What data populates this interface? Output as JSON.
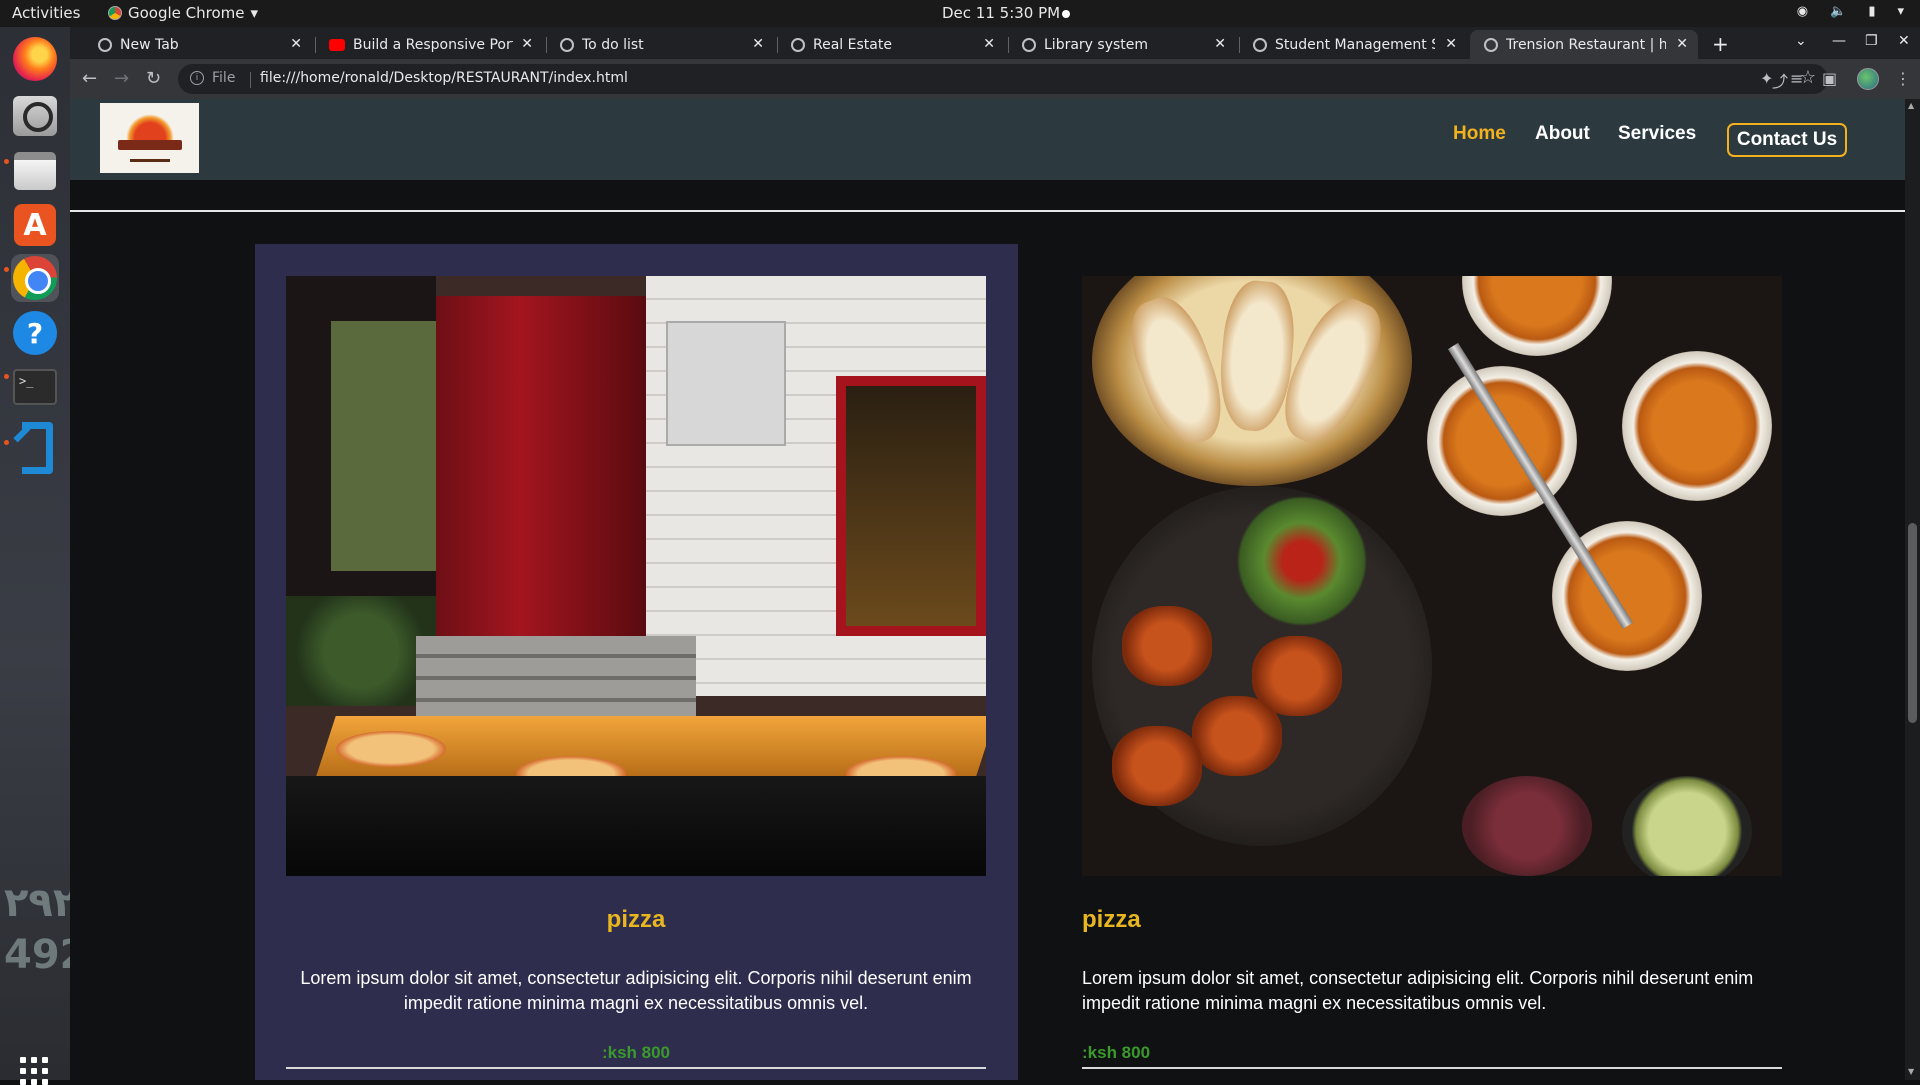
{
  "system": {
    "activities": "Activities",
    "app_name": "Google Chrome",
    "clock": "Dec 11  5:30 PM"
  },
  "dock": {
    "icons": [
      "firefox-icon",
      "magnifier-icon",
      "files-icon",
      "software-store-icon",
      "chrome-icon",
      "help-icon",
      "terminal-icon",
      "vscode-icon",
      "app-grid-icon"
    ],
    "store_glyph": "A",
    "help_glyph": "?",
    "terminal_glyph": ">_"
  },
  "browser": {
    "tabs": [
      {
        "title": "New Tab",
        "icon": "globe-icon"
      },
      {
        "title": "Build a Responsive Portf",
        "icon": "youtube-icon"
      },
      {
        "title": "To do list",
        "icon": "globe-icon"
      },
      {
        "title": "Real Estate",
        "icon": "globe-icon"
      },
      {
        "title": "Library system",
        "icon": "globe-icon"
      },
      {
        "title": "Student Management Sy",
        "icon": "globe-icon"
      },
      {
        "title": "Trension Restaurant | ho",
        "icon": "globe-icon",
        "active": true
      }
    ],
    "address": {
      "scheme": "File",
      "url": "file:///home/ronald/Desktop/RESTAURANT/index.html"
    }
  },
  "site": {
    "nav": {
      "home": "Home",
      "about": "About",
      "services": "Services",
      "contact": "Contact Us"
    },
    "accent_color": "#f2b21d",
    "cards": [
      {
        "title": "pizza",
        "text": "Lorem ipsum dolor sit amet, consectetur adipisicing elit. Corporis nihil deserunt enim impedit ratione minima magni ex necessitatibus omnis vel.",
        "price": ":ksh 800"
      },
      {
        "title": "pizza",
        "text": "Lorem ipsum dolor sit amet, consectetur adipisicing elit. Corporis nihil deserunt enim impedit ratione minima magni ex necessitatibus omnis vel.",
        "price": ":ksh 800"
      }
    ]
  }
}
